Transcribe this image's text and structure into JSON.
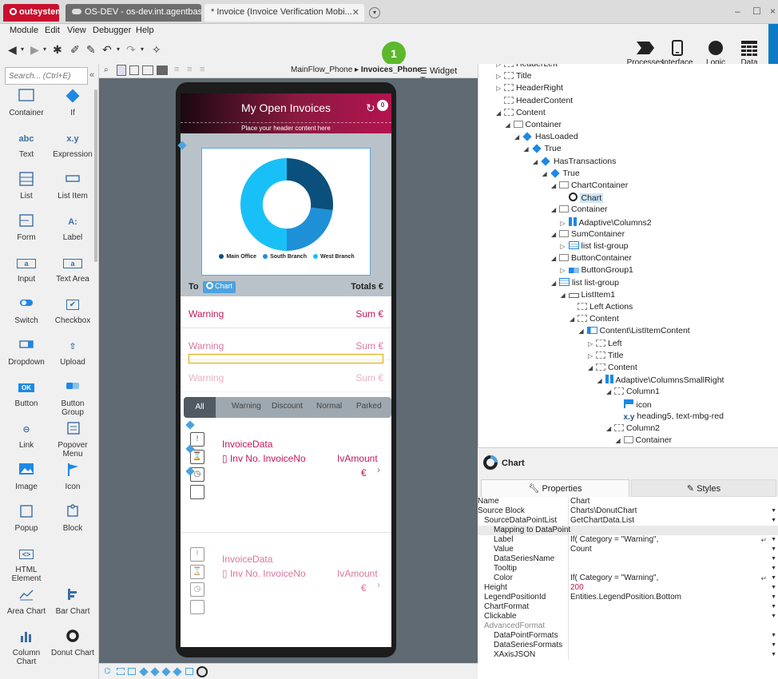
{
  "titlebar": {
    "brand": "outsystems",
    "env_tab": "OS-DEV - os-dev.int.agentbase.de",
    "module_tab": "* Invoice (Invoice Verification Mobi...",
    "close": "✕",
    "add": "▾",
    "minimize": "–",
    "maximize": "☐"
  },
  "menu": [
    "Module",
    "Edit",
    "View",
    "Debugger",
    "Help"
  ],
  "publish_count": "1",
  "right_tools": [
    {
      "label": "Processes"
    },
    {
      "label": "Interface"
    },
    {
      "label": "Logic"
    },
    {
      "label": "Data"
    }
  ],
  "toolbox": {
    "search_placeholder": "Search... (Ctrl+E)",
    "collapse": "«",
    "widgets": [
      {
        "label": "Container",
        "glyph": ""
      },
      {
        "label": "If",
        "glyph": ""
      },
      {
        "label": "Text",
        "glyph": "abc"
      },
      {
        "label": "Expression",
        "glyph": "x.y"
      },
      {
        "label": "List",
        "glyph": ""
      },
      {
        "label": "List Item",
        "glyph": ""
      },
      {
        "label": "Form",
        "glyph": ""
      },
      {
        "label": "Label",
        "glyph": "A:"
      },
      {
        "label": "Input",
        "glyph": "a"
      },
      {
        "label": "Text Area",
        "glyph": "a"
      },
      {
        "label": "Switch",
        "glyph": ""
      },
      {
        "label": "Checkbox",
        "glyph": "✔"
      },
      {
        "label": "Dropdown",
        "glyph": ""
      },
      {
        "label": "Upload",
        "glyph": "⇧"
      },
      {
        "label": "Button",
        "glyph": "OK"
      },
      {
        "label": "Button Group",
        "glyph": ""
      },
      {
        "label": "Link",
        "glyph": "⊖"
      },
      {
        "label": "Popover Menu",
        "glyph": ""
      },
      {
        "label": "Image",
        "glyph": ""
      },
      {
        "label": "Icon",
        "glyph": ""
      },
      {
        "label": "Popup",
        "glyph": ""
      },
      {
        "label": "Block",
        "glyph": ""
      },
      {
        "label": "HTML Element",
        "glyph": "<>"
      },
      {
        "label": "",
        "glyph": ""
      },
      {
        "label": "Area Chart",
        "glyph": ""
      },
      {
        "label": "Bar Chart",
        "glyph": ""
      },
      {
        "label": "Column Chart",
        "glyph": ""
      },
      {
        "label": "Donut Chart",
        "glyph": ""
      }
    ]
  },
  "canvas": {
    "breadcrumb_flow": "MainFlow_Phone",
    "breadcrumb_sep": "▸",
    "breadcrumb_screen": "Invoices_Phone",
    "widget_tree_tab": "Widget Tree"
  },
  "phone": {
    "title": "My Open Invoices",
    "badge": "0",
    "header_placeholder": "Place your header content here",
    "legend": [
      {
        "name": "Main Office",
        "color": "#0b4f7c"
      },
      {
        "name": "South Branch",
        "color": "#1e90d8"
      },
      {
        "name": "West Branch",
        "color": "#19c0f7"
      }
    ],
    "totals_left": "To",
    "chip": "Chart",
    "totals_right": "Totals €",
    "sums": [
      {
        "label": "Warning",
        "value": "Sum €"
      },
      {
        "label": "Warning",
        "value": "Sum €"
      },
      {
        "label": "Warning",
        "value": "Sum €"
      }
    ],
    "filters": [
      "All",
      "Warning",
      "Discount",
      "Normal",
      "Parked"
    ],
    "invoices": [
      {
        "title": "InvoiceData",
        "number": "Inv No. InvoiceNo",
        "amount": "IvAmount",
        "currency": "€",
        "chevron": "›"
      },
      {
        "title": "InvoiceData",
        "number": "Inv No. InvoiceNo",
        "amount": "IvAmount",
        "currency": "€",
        "chevron": "›"
      }
    ]
  },
  "chart_data": {
    "type": "pie",
    "categories": [
      "Main Office",
      "South Branch",
      "West Branch"
    ],
    "values": [
      27,
      23,
      50
    ],
    "colors": [
      "#0b4f7c",
      "#1e90d8",
      "#19c0f7"
    ],
    "hole": 0.52,
    "legend": "bottom",
    "title": "",
    "xlabel": "",
    "ylabel": ""
  },
  "tree": [
    {
      "label": "HeaderLeft",
      "indent": 0,
      "icon": "dbox",
      "exp": "▷"
    },
    {
      "label": "Title",
      "indent": 0,
      "icon": "dbox",
      "exp": "▷"
    },
    {
      "label": "HeaderRight",
      "indent": 0,
      "icon": "dbox",
      "exp": "▷"
    },
    {
      "label": "HeaderContent",
      "indent": 0,
      "icon": "dbox",
      "exp": ""
    },
    {
      "label": "Content",
      "indent": 0,
      "icon": "dbox",
      "exp": "◢"
    },
    {
      "label": "Container",
      "indent": 1,
      "icon": "box",
      "exp": "◢"
    },
    {
      "label": "HasLoaded",
      "indent": 2,
      "icon": "dia",
      "exp": "◢"
    },
    {
      "label": "True",
      "indent": 3,
      "icon": "dia",
      "exp": "◢"
    },
    {
      "label": "HasTransactions",
      "indent": 4,
      "icon": "dia",
      "exp": "◢"
    },
    {
      "label": "True",
      "indent": 5,
      "icon": "dia",
      "exp": "◢"
    },
    {
      "label": "ChartContainer",
      "indent": 6,
      "icon": "box",
      "exp": "◢"
    },
    {
      "label": "Chart",
      "indent": 7,
      "icon": "donut",
      "exp": "",
      "selected": true
    },
    {
      "label": "Container",
      "indent": 6,
      "icon": "box",
      "exp": "◢"
    },
    {
      "label": "Adaptive\\Columns2",
      "indent": 7,
      "icon": "cols",
      "exp": "▷"
    },
    {
      "label": "SumContainer",
      "indent": 6,
      "icon": "box",
      "exp": "◢"
    },
    {
      "label": "list list-group",
      "indent": 7,
      "icon": "list",
      "exp": "▷"
    },
    {
      "label": "ButtonContainer",
      "indent": 6,
      "icon": "box",
      "exp": "◢"
    },
    {
      "label": "ButtonGroup1",
      "indent": 7,
      "icon": "btng",
      "exp": "▷"
    },
    {
      "label": "list list-group",
      "indent": 6,
      "icon": "list",
      "exp": "◢"
    },
    {
      "label": "ListItem1",
      "indent": 7,
      "icon": "li",
      "exp": "◢"
    },
    {
      "label": "Left Actions",
      "indent": 8,
      "icon": "dbox",
      "exp": ""
    },
    {
      "label": "Content",
      "indent": 8,
      "icon": "dbox",
      "exp": "◢"
    },
    {
      "label": "Content\\ListItemContent",
      "indent": 9,
      "icon": "lic",
      "exp": "◢"
    },
    {
      "label": "Left",
      "indent": 10,
      "icon": "dbox",
      "exp": "▷"
    },
    {
      "label": "Title",
      "indent": 10,
      "icon": "dbox",
      "exp": "▷"
    },
    {
      "label": "Content",
      "indent": 10,
      "icon": "dbox",
      "exp": "◢"
    },
    {
      "label": "Adaptive\\ColumnsSmallRight",
      "indent": 11,
      "icon": "cols",
      "exp": "◢"
    },
    {
      "label": "Column1",
      "indent": 12,
      "icon": "dbox",
      "exp": "◢"
    },
    {
      "label": "icon",
      "indent": 13,
      "icon": "flag",
      "exp": ""
    },
    {
      "label": "heading5, text-mbg-red",
      "indent": 13,
      "icon": "xy",
      "exp": ""
    },
    {
      "label": "Column2",
      "indent": 12,
      "icon": "dbox",
      "exp": "◢"
    },
    {
      "label": "Container",
      "indent": 13,
      "icon": "box",
      "exp": "◢"
    }
  ],
  "props": {
    "title": "Chart",
    "tab_properties": "Properties",
    "tab_styles": "Styles",
    "rows": [
      {
        "key": "Name",
        "value": "Chart",
        "indent": 0,
        "dd": false
      },
      {
        "key": "Source Block",
        "value": "Charts\\DonutChart",
        "indent": 0,
        "dd": true
      },
      {
        "key": "SourceDataPointList",
        "value": "GetChartData.List",
        "indent": 1,
        "dd": true
      },
      {
        "key": "Mapping to DataPoint",
        "value": "",
        "indent": 2,
        "dd": false,
        "group": true
      },
      {
        "key": "Label",
        "value": "If( Category = \"Warning\",",
        "indent": 2,
        "dd": true,
        "ret": true
      },
      {
        "key": "Value",
        "value": "Count",
        "indent": 2,
        "dd": true
      },
      {
        "key": "DataSeriesName",
        "value": "",
        "indent": 2,
        "dd": true
      },
      {
        "key": "Tooltip",
        "value": "",
        "indent": 2,
        "dd": true
      },
      {
        "key": "Color",
        "value": "If( Category = \"Warning\",",
        "indent": 2,
        "dd": true,
        "ret": true
      },
      {
        "key": "Height",
        "value": "200",
        "indent": 1,
        "dd": true,
        "accent": true
      },
      {
        "key": "LegendPositionId",
        "value": "Entities.LegendPosition.Bottom",
        "indent": 1,
        "dd": true
      },
      {
        "key": "ChartFormat",
        "value": "",
        "indent": 1,
        "dd": true
      },
      {
        "key": "Clickable",
        "value": "",
        "indent": 1,
        "dd": true
      },
      {
        "key": "AdvancedFormat",
        "value": "",
        "indent": 1,
        "dd": false,
        "muted": true
      },
      {
        "key": "DataPointFormats",
        "value": "",
        "indent": 2,
        "dd": true
      },
      {
        "key": "DataSeriesFormats",
        "value": "",
        "indent": 2,
        "dd": true
      },
      {
        "key": "XAxisJSON",
        "value": "",
        "indent": 2,
        "dd": true
      }
    ]
  }
}
